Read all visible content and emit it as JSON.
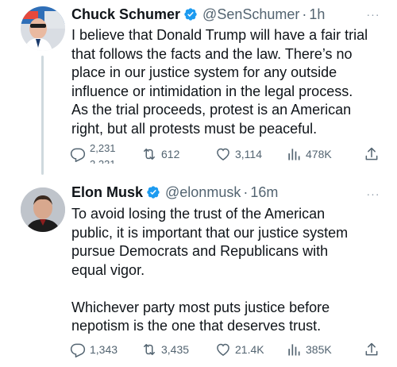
{
  "tweets": [
    {
      "name": "Chuck Schumer",
      "handle": "@SenSchumer",
      "separator": "·",
      "time": "1h",
      "more": "···",
      "text": "I believe that Donald Trump will have a fair trial\nthat follows the facts and the law. There’s no\nplace in our justice system for any outside\ninfluence or intimidation in the legal process.\nAs the trial proceeds, protest is an American\nright, but all protests must be peaceful.",
      "replies": "2,231",
      "retweets": "612",
      "likes": "3,114",
      "views": "478K"
    },
    {
      "name": "Elon Musk",
      "handle": "@elonmusk",
      "separator": "·",
      "time": "16m",
      "more": "···",
      "text": "To avoid losing the trust of the American\npublic, it is important that our justice system\npursue Democrats and Republicans with\nequal vigor.\n\nWhichever party most puts justice before\nnepotism is the one that deserves trust.",
      "replies": "1,343",
      "retweets": "3,435",
      "likes": "21.4K",
      "views": "385K"
    }
  ],
  "colors": {
    "verified": "#1d9bf0",
    "text": "#0f1419",
    "secondary": "#536471",
    "thread_line": "#cfd9de"
  },
  "icons": [
    "reply-icon",
    "retweet-icon",
    "like-icon",
    "views-icon",
    "share-icon",
    "verified-badge-icon",
    "more-icon"
  ]
}
